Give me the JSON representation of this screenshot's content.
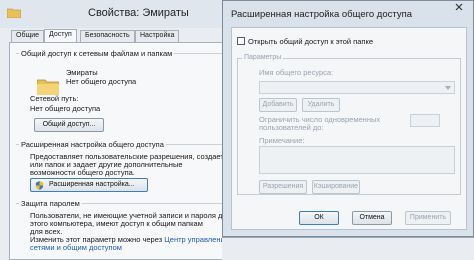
{
  "properties": {
    "title": "Свойства: Эмираты",
    "tabs": [
      "Общие",
      "Доступ",
      "Безопасность",
      "Настройка"
    ],
    "network_sharing": {
      "heading": "Общий доступ к сетевым файлам и папкам",
      "folder_name": "Эмираты",
      "folder_status": "Нет общего доступа",
      "path_label": "Сетевой путь:",
      "path_value": "Нет общего доступа",
      "share_button": "Общий доступ..."
    },
    "advanced_sharing": {
      "heading": "Расширенная настройка общего доступа",
      "desc1": "Предоставляет пользовательские разрешения, создает",
      "desc2": "или папок и задает другие дополнительные",
      "desc3": "возможности общего доступа.",
      "button": "Расширенная настройка..."
    },
    "password": {
      "heading": "Защита паролем",
      "text1": "Пользователи, не имеющие учетной записи и пароля для",
      "text2": "этого компьютера, имеют доступ к общим папкам",
      "text3": "для всех.",
      "text4_prefix": "Изменить этот параметр можно через",
      "link1": "Центр управления",
      "link2": "сетями и общим доступом"
    }
  },
  "dialog": {
    "title": "Расширенная настройка общего доступа",
    "share_checkbox": "Открыть общий доступ к этой папке",
    "share_checked": false,
    "params_label": "Параметры",
    "share_name_label": "Имя общего ресурса:",
    "add_button": "Добавить",
    "remove_button": "Удалить",
    "limit_label_1": "Ограничить число одновременных",
    "limit_label_2": "пользователей до:",
    "note_label": "Примечание:",
    "permissions_button": "Разрешения",
    "caching_button": "Кэширование",
    "ok_button": "ОК",
    "cancel_button": "Отмена",
    "apply_button": "Применить"
  }
}
